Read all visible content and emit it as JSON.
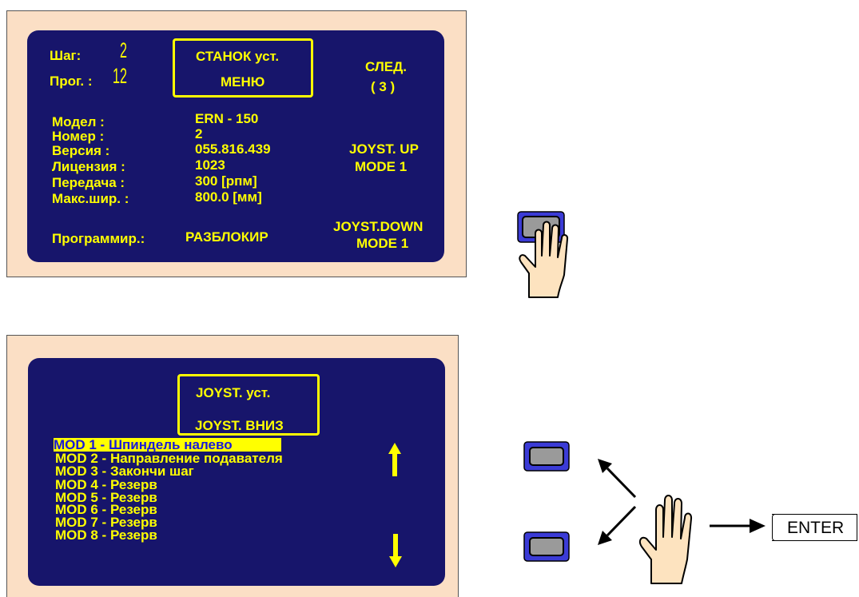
{
  "top_screen": {
    "step_label": "Шаг:",
    "step_value": "2",
    "prog_label": "Прог. :",
    "prog_value": "12",
    "title_line1": "СТАНОК  уст.",
    "title_line2": "МЕНЮ",
    "next_line1": "СЛЕД.",
    "next_line2": "( 3 )",
    "rows": [
      {
        "label": "Модел :",
        "value": "ERN - 150"
      },
      {
        "label": "Номер :",
        "value": "2"
      },
      {
        "label": "Версия :",
        "value": "055.816.439"
      },
      {
        "label": "Лицензия :",
        "value": "1023"
      },
      {
        "label": "Передача :",
        "value": "300 [рпм]"
      },
      {
        "label": "Макс.шир. :",
        "value": "800.0 [мм]"
      }
    ],
    "joy_up_line1": "JOYST. UP",
    "joy_up_line2": "MODE 1",
    "joy_down_line1": "JOYST.DOWN",
    "joy_down_line2": "MODE 1",
    "prog_mode_label": "Программир.:",
    "prog_mode_value": "РАЗБЛОКИР"
  },
  "bottom_screen": {
    "title_line1": "JOYST. уст.",
    "title_line2": "JOYST. ВНИЗ",
    "modes": [
      "MOD 1 - Шпиндель налево",
      "MOD 2 - Направление подавателя",
      "MOD 3 - Закончи шаг",
      "MOD 4 - Резерв",
      "MOD 5 - Резерв",
      "MOD 6 - Резерв",
      "MOD 7 - Резерв",
      "MOD 8 - Резерв"
    ],
    "selected_index": 0
  },
  "enter_label": "ENTER",
  "colors": {
    "frame": "#fbdfc5",
    "screen": "#17156b",
    "text": "#ffff00",
    "highlight_text": "#1a1ad8",
    "button": "#3b3bd6"
  },
  "icons": [
    "hand-press-icon",
    "hand-icon",
    "arrow-up-icon",
    "arrow-down-icon",
    "arrow-right-icon",
    "button-icon"
  ]
}
